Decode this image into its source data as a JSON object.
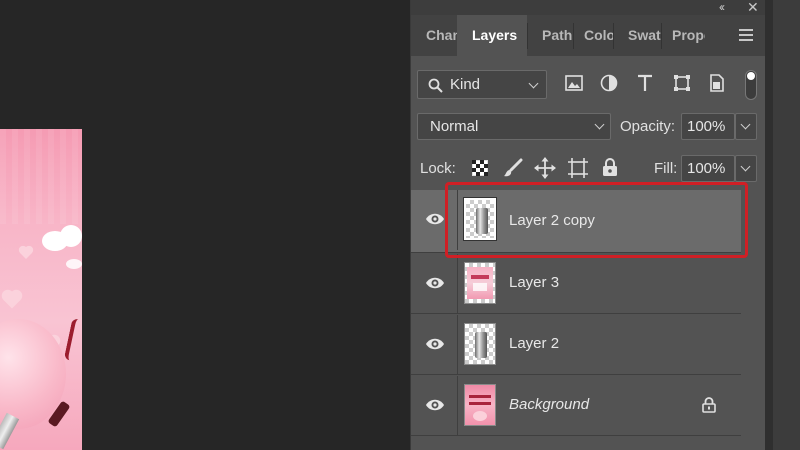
{
  "panel": {
    "collapse_icon": "double-chevron-left-icon",
    "close_icon": "close-icon",
    "tabs": [
      {
        "label": "Channels",
        "active": false
      },
      {
        "label": "Layers",
        "active": true
      },
      {
        "label": "Paths",
        "active": false
      },
      {
        "label": "Color",
        "active": false
      },
      {
        "label": "Swatches",
        "active": false
      },
      {
        "label": "Properties",
        "active": false
      }
    ],
    "menu_icon": "hamburger-menu-icon"
  },
  "filter": {
    "kind_label": "Kind",
    "icons": [
      "image-filter-icon",
      "adjustment-filter-icon",
      "type-filter-icon",
      "shape-filter-icon",
      "smart-object-filter-icon",
      "filter-toggle-icon"
    ]
  },
  "blend": {
    "mode": "Normal",
    "opacity_label": "Opacity:",
    "opacity_value": "100%"
  },
  "lock": {
    "label": "Lock:",
    "icons": [
      "lock-transparent-pixels-icon",
      "lock-image-pixels-icon",
      "lock-position-icon",
      "artboard-nesting-icon",
      "lock-all-icon"
    ],
    "fill_label": "Fill:",
    "fill_value": "100%"
  },
  "layers": [
    {
      "name": "Layer 2 copy",
      "selected": true,
      "thumb": "cylinder",
      "italic": false,
      "locked": false
    },
    {
      "name": "Layer 3",
      "selected": false,
      "thumb": "pink-card",
      "italic": false,
      "locked": false
    },
    {
      "name": "Layer 2",
      "selected": false,
      "thumb": "cylinder",
      "italic": false,
      "locked": false
    },
    {
      "name": "Background",
      "selected": false,
      "thumb": "pink-poster",
      "italic": true,
      "locked": true
    }
  ],
  "colors": {
    "panel_bg": "#535353",
    "selected_row": "#6b6b6b",
    "highlight": "#d01f25",
    "canvas_bg": "#262626"
  }
}
